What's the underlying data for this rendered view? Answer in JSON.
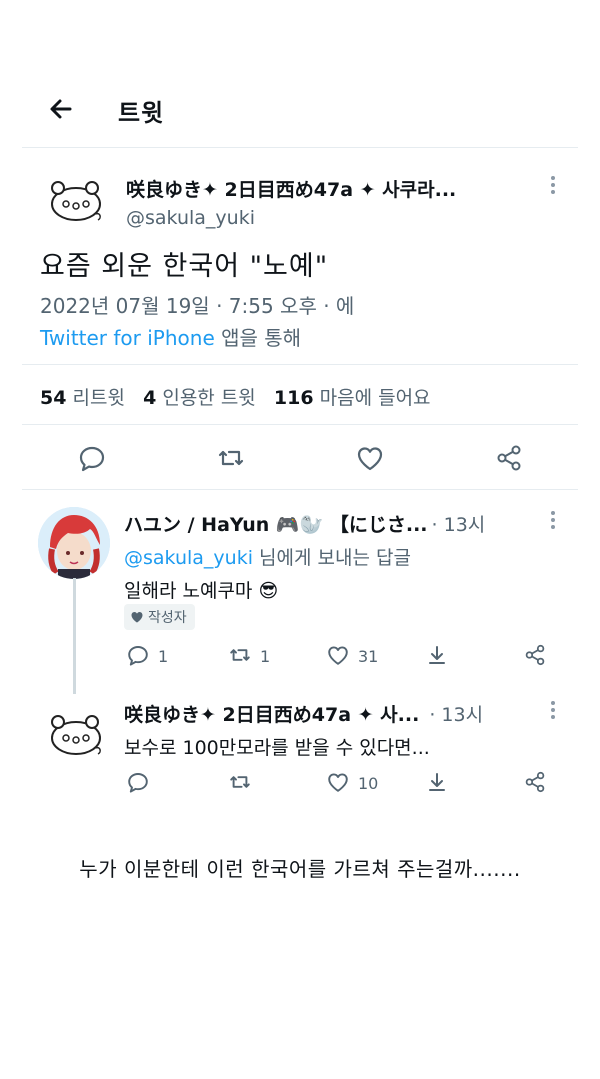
{
  "header": {
    "title": "트윗"
  },
  "main_tweet": {
    "display_name": "咲良ゆき✦ 2日目西め47a ✦ 사쿠라...",
    "handle": "@sakula_yuki",
    "text": "요즘 외운 한국어 \"노예\"",
    "meta": "2022년 07월 19일 · 7:55 오후 · 에",
    "client": "Twitter for iPhone",
    "client_suffix": " 앱을 통해",
    "stats": {
      "retweets_count": "54",
      "retweets_label": " 리트윗",
      "quotes_count": "4",
      "quotes_label": " 인용한 트윗",
      "likes_count": "116",
      "likes_label": " 마음에 들어요"
    }
  },
  "reply1": {
    "display_name": "ハユン / HaYun 🎮🦭 【にじさ...",
    "time": "· 13시",
    "reply_to_mention": "@sakula_yuki",
    "reply_to_suffix": " 님에게 보내는 답글",
    "text": "일해라 노예쿠마 😎",
    "badge": "작성자",
    "replies": "1",
    "retweets": "1",
    "likes": "31"
  },
  "reply2": {
    "display_name": "咲良ゆき✦ 2日目西め47a ✦ 사...",
    "time": "· 13시",
    "text": "보수로 100만모라를 받을 수 있다면...",
    "replies": "",
    "retweets": "",
    "likes": "10"
  },
  "caption": "누가 이분한테 이런 한국어를 가르쳐 주는걸까.......",
  "colors": {
    "link": "#1d9bf0",
    "secondary_text": "#536471",
    "divider": "#e6ecf0",
    "avatar_hair": "#d83a3a"
  },
  "icons": [
    "back-arrow-icon",
    "more-icon",
    "reply-icon",
    "retweet-icon",
    "like-icon",
    "share-icon",
    "download-icon",
    "heart-badge-icon"
  ]
}
